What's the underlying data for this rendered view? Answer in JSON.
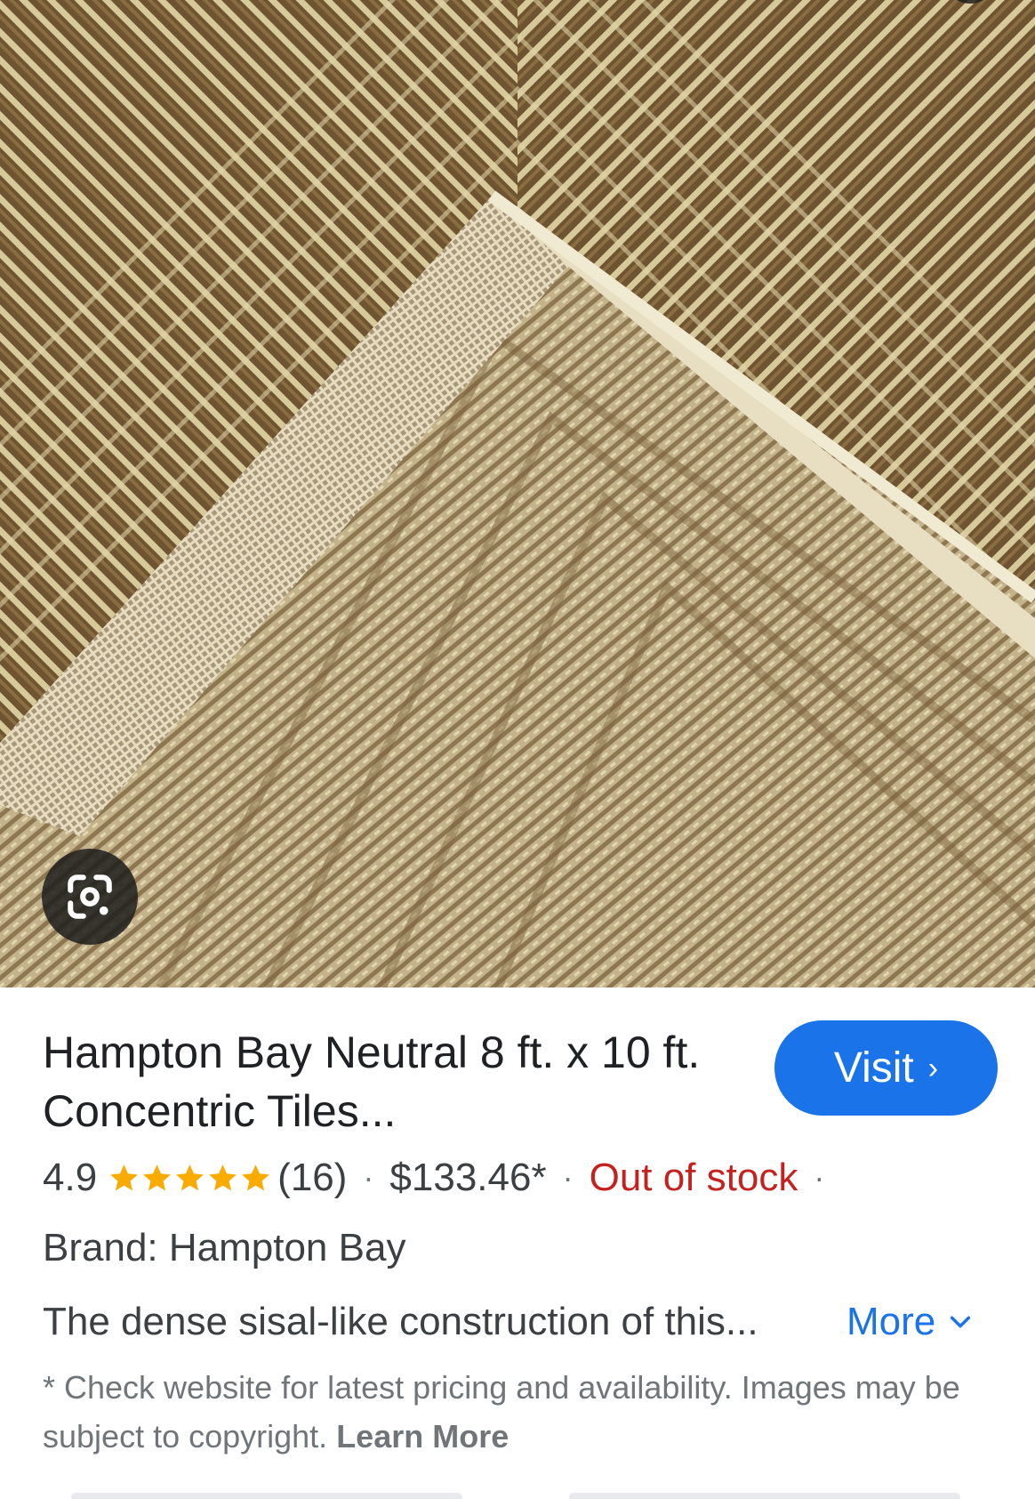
{
  "product": {
    "title": "Hampton Bay Neutral 8 ft. x 10 ft. Concentric Tiles...",
    "visit_label": "Visit",
    "rating": "4.9",
    "rating_value": 4.9,
    "review_count": "(16)",
    "price": "$133.46*",
    "stock": "Out of stock",
    "separator": "·",
    "brand": "Brand: Hampton Bay",
    "description": "The dense sisal-like construction of this...",
    "more_label": "More",
    "disclaimer": "* Check website for latest pricing and availability. Images may be subject to copyright.",
    "learn_more": "Learn More"
  },
  "icons": {
    "lens": "google-lens-icon",
    "visit_chevron": "chevron-right-icon",
    "star": "star-icon",
    "more_chevron": "chevron-down-icon"
  },
  "colors": {
    "accent": "#1a73e8",
    "star": "#f9ab00",
    "out_of_stock": "#c5221f",
    "text_primary": "#202124",
    "text_secondary": "#3c4043",
    "text_muted": "#70757a"
  }
}
